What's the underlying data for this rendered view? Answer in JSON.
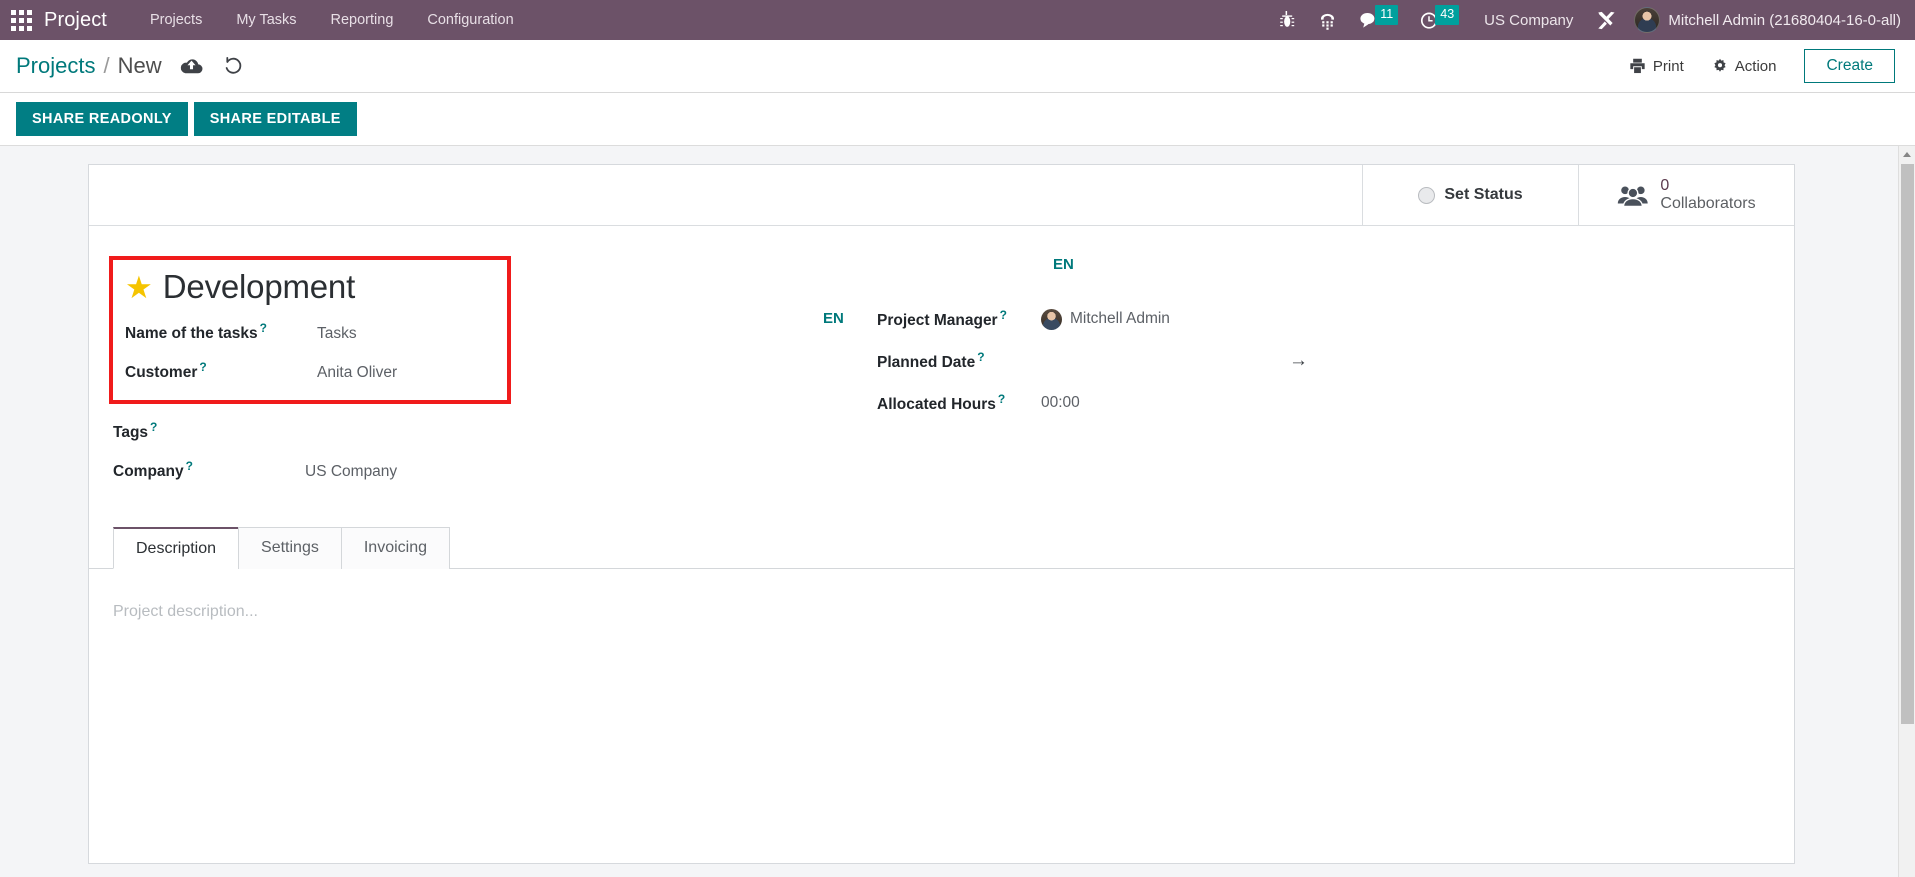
{
  "navbar": {
    "apps_icon": "apps-grid-icon",
    "brand": "Project",
    "menus": [
      "Projects",
      "My Tasks",
      "Reporting",
      "Configuration"
    ],
    "system_icons": [
      {
        "name": "bug-icon",
        "glyph": "☸"
      },
      {
        "name": "phone-icon",
        "glyph": "☎"
      }
    ],
    "messages": {
      "icon": "chat-bubble-icon",
      "count": "11"
    },
    "activities": {
      "icon": "clock-icon",
      "count": "43"
    },
    "company": "US Company",
    "debug_icon": "tools-icon",
    "user": "Mitchell Admin (21680404-16-0-all)"
  },
  "control_panel": {
    "breadcrumb_root": "Projects",
    "breadcrumb_sep": "/",
    "breadcrumb_current": "New",
    "save_icon": "cloud-upload-icon",
    "discard_icon": "undo-icon",
    "print_label": "Print",
    "print_icon": "printer-icon",
    "action_label": "Action",
    "action_icon": "gear-icon",
    "create_label": "Create"
  },
  "share_bar": {
    "readonly_label": "SHARE READONLY",
    "editable_label": "SHARE EDITABLE"
  },
  "statusbar": {
    "set_status_label": "Set Status",
    "status_icon": "status-circle-icon",
    "collaborators_icon": "users-group-icon",
    "collaborators_count": "0",
    "collaborators_label": "Collaborators"
  },
  "record": {
    "star_icon": "star-icon",
    "title": "Development",
    "translation_badge": "EN"
  },
  "left_fields": [
    {
      "label": "Name of the tasks",
      "help": "?",
      "value": "Tasks",
      "translate": "EN"
    },
    {
      "label": "Customer",
      "help": "?",
      "value": "Anita Oliver",
      "translate": ""
    },
    {
      "label": "Tags",
      "help": "?",
      "value": "",
      "translate": ""
    },
    {
      "label": "Company",
      "help": "?",
      "value": "US Company",
      "translate": ""
    }
  ],
  "right_fields": [
    {
      "label": "Project Manager",
      "help": "?",
      "value": "Mitchell Admin",
      "avatar": "user-avatar"
    },
    {
      "label": "Planned Date",
      "help": "?",
      "value": "",
      "arrow": "→"
    },
    {
      "label": "Allocated Hours",
      "help": "?",
      "value": "00:00"
    }
  ],
  "notebook": {
    "tabs": [
      {
        "label": "Description",
        "active": true
      },
      {
        "label": "Settings",
        "active": false
      },
      {
        "label": "Invoicing",
        "active": false
      }
    ],
    "description_placeholder": "Project description..."
  },
  "colors": {
    "navbar_bg": "#6c5268",
    "accent_teal": "#00797b",
    "share_button": "#017e84",
    "badge_teal": "#00a09d",
    "highlight_red": "#f01b1b",
    "star_yellow": "#f5c400"
  }
}
